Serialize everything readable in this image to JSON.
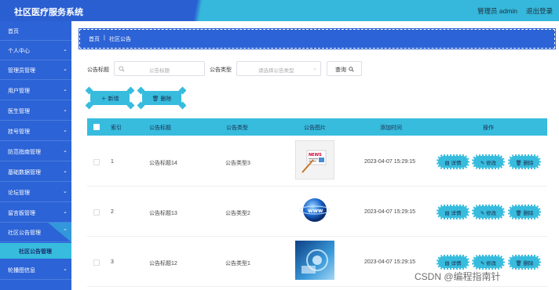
{
  "header": {
    "title": "社区医疗服务系统",
    "user": "管理员 admin",
    "logout": "退出登录"
  },
  "sidebar": {
    "items": [
      {
        "label": "首页",
        "chevron": ""
      },
      {
        "label": "个人中心",
        "chevron": "⌄"
      },
      {
        "label": "管理员管理",
        "chevron": "⌄"
      },
      {
        "label": "用户管理",
        "chevron": "⌄"
      },
      {
        "label": "医生管理",
        "chevron": "⌄"
      },
      {
        "label": "挂号管理",
        "chevron": "⌄"
      },
      {
        "label": "防范指南管理",
        "chevron": "⌄"
      },
      {
        "label": "基础数据管理",
        "chevron": "⌄"
      },
      {
        "label": "论坛管理",
        "chevron": "⌄"
      },
      {
        "label": "留言板管理",
        "chevron": "⌄"
      },
      {
        "label": "社区公告管理",
        "chevron": "⌃"
      },
      {
        "label": "轮播图信息",
        "chevron": "⌄"
      }
    ],
    "sub_item": "社区公告管理"
  },
  "breadcrumb": {
    "home": "首页",
    "sep": "|",
    "current": "社区公告"
  },
  "search": {
    "title_label": "公告标题",
    "title_placeholder": "公告标题",
    "type_label": "公告类型",
    "type_placeholder": "请选择公告类型",
    "query_button": "查询"
  },
  "toolbar": {
    "add": "新增",
    "delete": "删除"
  },
  "table": {
    "headers": [
      "索引",
      "公告标题",
      "公告类型",
      "公告图片",
      "添加时间",
      "操作"
    ],
    "rows": [
      {
        "index": "1",
        "title": "公告标题14",
        "type": "公告类型3",
        "image": "news-thumbnail",
        "time": "2023-04-07 15:29:15"
      },
      {
        "index": "2",
        "title": "公告标题13",
        "type": "公告类型2",
        "image": "globe-thumbnail",
        "time": "2023-04-07 15:29:15"
      },
      {
        "index": "3",
        "title": "公告标题12",
        "type": "公告类型1",
        "image": "tech-thumbnail",
        "time": "2023-04-07 15:29:15"
      }
    ],
    "actions": {
      "detail": "详情",
      "edit": "修改",
      "delete": "删除"
    }
  },
  "watermark": "CSDN @编程指南针",
  "colors": {
    "primary": "#2c63d6",
    "accent": "#37bcde"
  }
}
